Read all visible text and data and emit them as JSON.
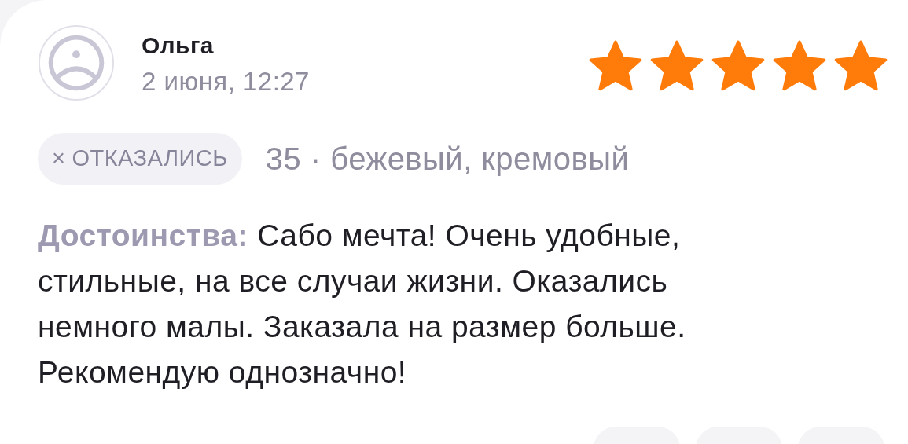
{
  "review": {
    "author": "Ольга",
    "date": "2 июня, 12:27",
    "stars": 5,
    "chip": {
      "icon": "×",
      "label": "ОТКАЗАЛИСЬ"
    },
    "variant": "35 · бежевый, кремовый",
    "text": "**Достоинства:** Сабо мечта! Очень удобные, стильные, на все случаи жизни. Оказались немного малы. Заказала на размер больше. Рекомендую однозначно!",
    "actions": [
      {
        "kind": "pill"
      },
      {
        "kind": "pill"
      },
      {
        "kind": "pill"
      }
    ]
  }
}
